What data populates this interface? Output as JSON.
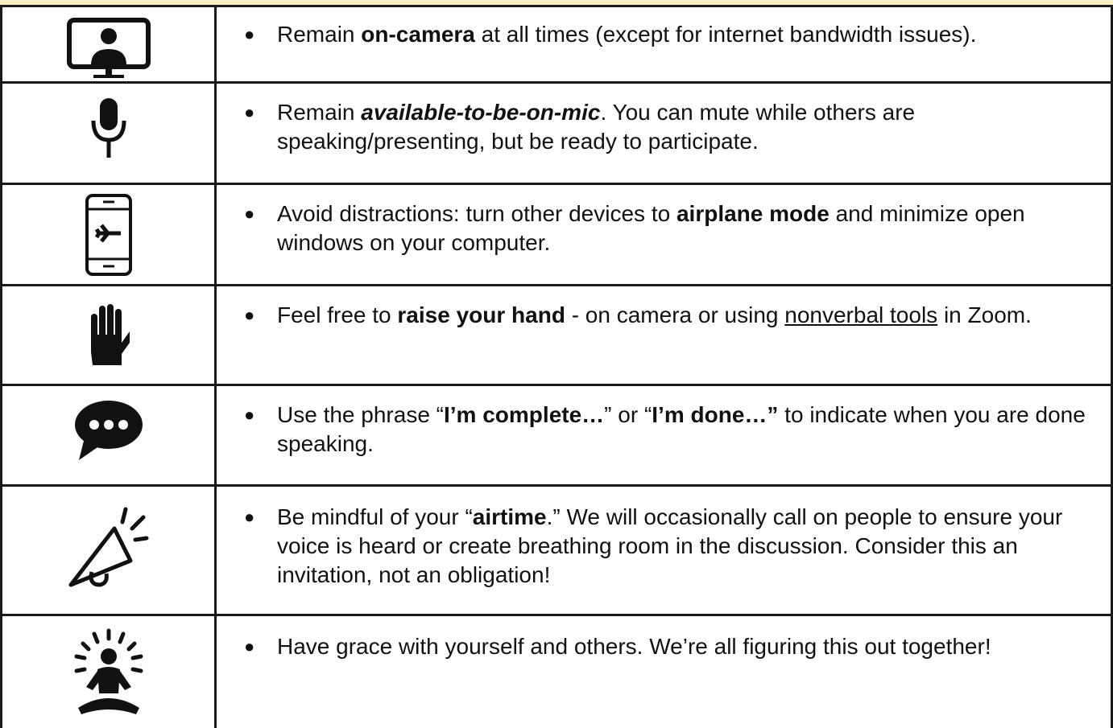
{
  "norms": [
    {
      "icon": "video-call-icon",
      "parts": [
        {
          "text": "Remain ",
          "style": "normal"
        },
        {
          "text": "on-camera",
          "style": "bold"
        },
        {
          "text": " at all times (except for internet bandwidth issues).",
          "style": "normal"
        }
      ]
    },
    {
      "icon": "microphone-icon",
      "parts": [
        {
          "text": "Remain ",
          "style": "normal"
        },
        {
          "text": "available-to-be-on-mic",
          "style": "bold-italic"
        },
        {
          "text": ". You can mute while others are speaking/presenting, but be ready to participate.",
          "style": "normal"
        }
      ]
    },
    {
      "icon": "phone-airplane-mode-icon",
      "parts": [
        {
          "text": "Avoid distractions: turn other devices to ",
          "style": "normal"
        },
        {
          "text": "airplane mode",
          "style": "bold"
        },
        {
          "text": " and minimize open windows on your computer.",
          "style": "normal"
        }
      ]
    },
    {
      "icon": "raised-hand-icon",
      "parts": [
        {
          "text": "Feel free to ",
          "style": "normal"
        },
        {
          "text": "raise your hand",
          "style": "bold"
        },
        {
          "text": " - on camera or using ",
          "style": "normal"
        },
        {
          "text": "nonverbal tools",
          "style": "underline"
        },
        {
          "text": " in Zoom.",
          "style": "normal"
        }
      ]
    },
    {
      "icon": "speech-bubble-icon",
      "parts": [
        {
          "text": "Use the phrase “",
          "style": "normal"
        },
        {
          "text": "I’m complete…",
          "style": "bold"
        },
        {
          "text": "” or “",
          "style": "normal"
        },
        {
          "text": "I’m done…”",
          "style": "bold"
        },
        {
          "text": " to indicate when you are done speaking.",
          "style": "normal"
        }
      ]
    },
    {
      "icon": "megaphone-icon",
      "parts": [
        {
          "text": "Be mindful of your “",
          "style": "normal"
        },
        {
          "text": "airtime",
          "style": "bold"
        },
        {
          "text": ".”  We will occasionally call on people to ensure your voice is heard or create breathing room in the discussion.  Consider this an invitation, not an obligation!",
          "style": "normal"
        }
      ]
    },
    {
      "icon": "meditation-icon",
      "parts": [
        {
          "text": "Have grace with yourself and others.  We’re all figuring this out together!",
          "style": "normal"
        }
      ]
    }
  ]
}
